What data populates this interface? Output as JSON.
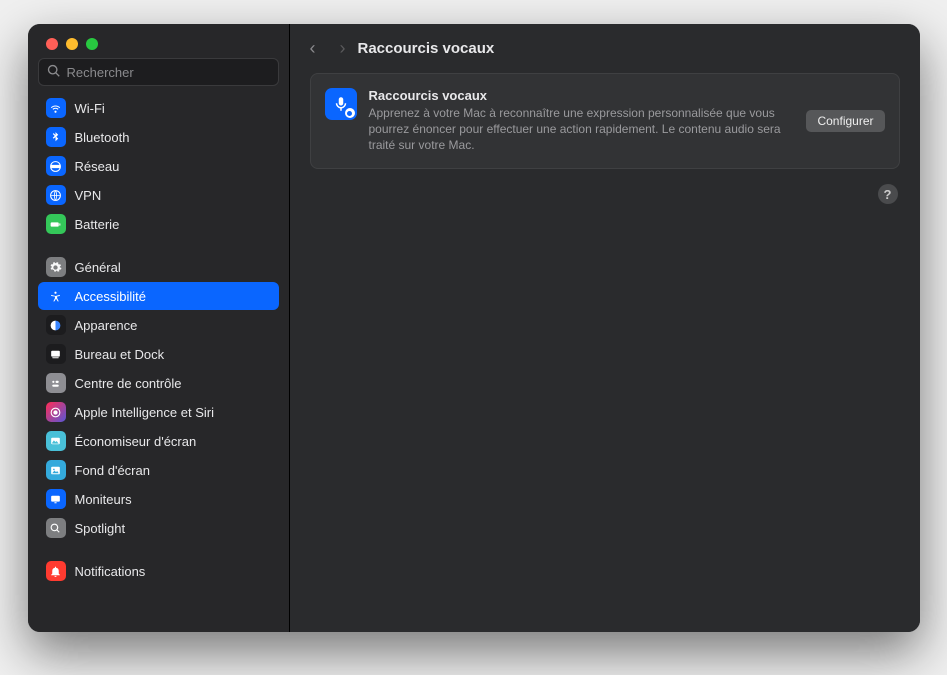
{
  "search": {
    "placeholder": "Rechercher"
  },
  "header": {
    "title": "Raccourcis vocaux"
  },
  "card": {
    "title": "Raccourcis vocaux",
    "desc": "Apprenez à votre Mac à reconnaître une expression personnalisée que vous pourrez énoncer pour effectuer une action rapidement. Le contenu audio sera traité sur votre Mac.",
    "button": "Configurer"
  },
  "help": {
    "label": "?"
  },
  "sidebar": {
    "groups": [
      {
        "items": [
          {
            "label": "Wi-Fi",
            "icon": "wifi",
            "bg": "#0a66ff"
          },
          {
            "label": "Bluetooth",
            "icon": "bluetooth",
            "bg": "#0a66ff"
          },
          {
            "label": "Réseau",
            "icon": "network",
            "bg": "#0a66ff"
          },
          {
            "label": "VPN",
            "icon": "vpn",
            "bg": "#0a66ff"
          },
          {
            "label": "Batterie",
            "icon": "battery",
            "bg": "#34c759"
          }
        ]
      },
      {
        "items": [
          {
            "label": "Général",
            "icon": "gear",
            "bg": "#7d7e80"
          },
          {
            "label": "Accessibilité",
            "icon": "accessibility",
            "bg": "#0a66ff",
            "selected": true
          },
          {
            "label": "Apparence",
            "icon": "appearance",
            "bg": "#1c1c1e"
          },
          {
            "label": "Bureau et Dock",
            "icon": "dock",
            "bg": "#1c1c1e"
          },
          {
            "label": "Centre de contrôle",
            "icon": "control",
            "bg": "#8e8e93"
          },
          {
            "label": "Apple Intelligence et Siri",
            "icon": "siri",
            "bg": "linear-gradient(135deg,#ff2d55,#5856d6)"
          },
          {
            "label": "Économiseur d'écran",
            "icon": "screensaver",
            "bg": "#49c0d8"
          },
          {
            "label": "Fond d'écran",
            "icon": "wallpaper",
            "bg": "#34aadc"
          },
          {
            "label": "Moniteurs",
            "icon": "displays",
            "bg": "#0a66ff"
          },
          {
            "label": "Spotlight",
            "icon": "spotlight",
            "bg": "#7d7e80"
          }
        ]
      },
      {
        "items": [
          {
            "label": "Notifications",
            "icon": "bell",
            "bg": "#ff3b30"
          }
        ]
      }
    ]
  }
}
